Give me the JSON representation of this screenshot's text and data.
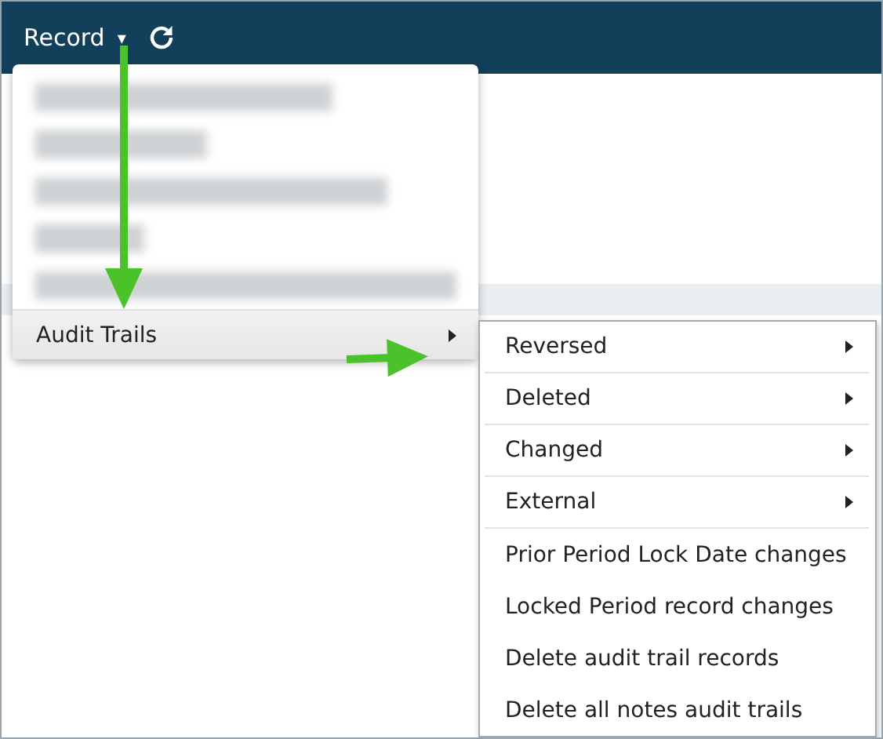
{
  "toolbar": {
    "menu_label": "Record",
    "caret": "▾"
  },
  "menu": {
    "items": [
      {
        "kind": "redacted"
      },
      {
        "kind": "redacted"
      },
      {
        "kind": "redacted"
      },
      {
        "kind": "redacted"
      },
      {
        "kind": "redacted"
      },
      {
        "kind": "submenu",
        "label": "Audit Trails",
        "selected": true
      }
    ]
  },
  "submenu": {
    "items": [
      {
        "label": "Reversed",
        "has_submenu": true
      },
      {
        "label": "Deleted",
        "has_submenu": true
      },
      {
        "label": "Changed",
        "has_submenu": true
      },
      {
        "label": "External",
        "has_submenu": true
      },
      {
        "label": "Prior Period Lock Date changes",
        "has_submenu": false
      },
      {
        "label": "Locked Period record changes",
        "has_submenu": false
      },
      {
        "label": "Delete audit trail records",
        "has_submenu": false
      },
      {
        "label": "Delete all notes audit trails",
        "has_submenu": false
      }
    ]
  },
  "annotations": [
    {
      "kind": "arrow-down"
    },
    {
      "kind": "arrow-right"
    }
  ]
}
